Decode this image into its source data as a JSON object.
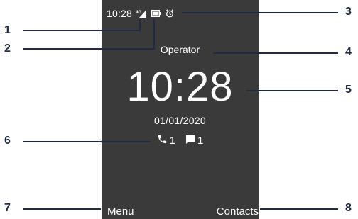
{
  "screen": {
    "status_bar": {
      "time": "10:28",
      "network_label": "4G",
      "icons": [
        "signal-icon",
        "battery-icon",
        "alarm-icon"
      ]
    },
    "operator": "Operator",
    "clock": "10:28",
    "date": "01/01/2020",
    "notifications": {
      "missed_calls": "1",
      "messages": "1"
    },
    "softkeys": {
      "left": "Menu",
      "right": "Contacts"
    }
  },
  "callouts": [
    "1",
    "2",
    "3",
    "4",
    "5",
    "6",
    "7",
    "8"
  ],
  "colors": {
    "screen_background": "#3a3a3a",
    "text": "#ffffff",
    "callout": "#1f2a44"
  }
}
